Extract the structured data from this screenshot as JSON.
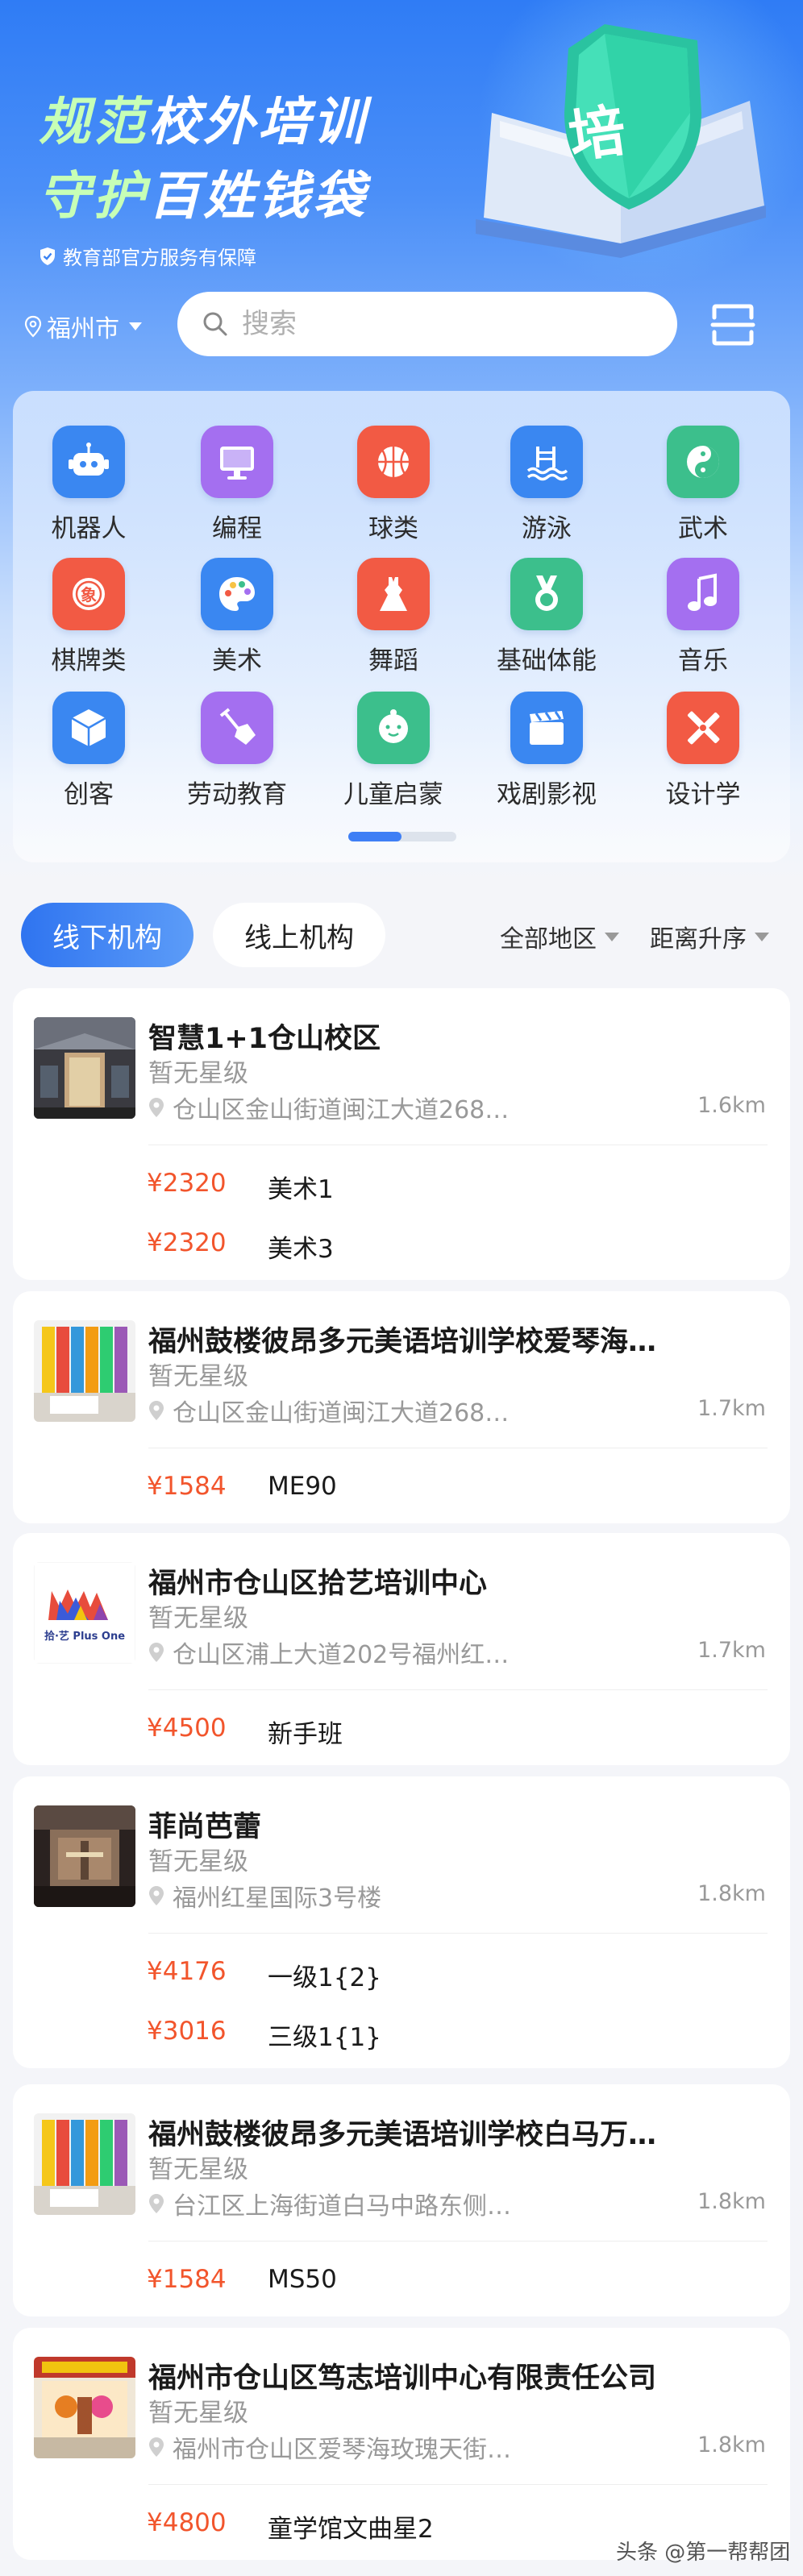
{
  "banner": {
    "line1_hl": "规范",
    "line1_rest": "校外培训",
    "line2_hl": "守护",
    "line2_rest": "百姓钱袋",
    "subtitle": "教育部官方服务有保障",
    "badge_char": "培"
  },
  "location": {
    "city": "福州市"
  },
  "search": {
    "placeholder": "搜索"
  },
  "categories": [
    {
      "label": "机器人",
      "icon": "robot-icon",
      "color": "#3a87f1"
    },
    {
      "label": "编程",
      "icon": "monitor-icon",
      "color": "#a46ff0"
    },
    {
      "label": "球类",
      "icon": "basketball-icon",
      "color": "#f25a44"
    },
    {
      "label": "游泳",
      "icon": "swimming-icon",
      "color": "#3a87f1"
    },
    {
      "label": "武术",
      "icon": "taiji-icon",
      "color": "#3cbf8c"
    },
    {
      "label": "棋牌类",
      "icon": "chess-icon",
      "color": "#f25a44"
    },
    {
      "label": "美术",
      "icon": "palette-icon",
      "color": "#3a87f1"
    },
    {
      "label": "舞蹈",
      "icon": "dress-icon",
      "color": "#f25a44"
    },
    {
      "label": "基础体能",
      "icon": "medal-icon",
      "color": "#3cbf8c"
    },
    {
      "label": "音乐",
      "icon": "music-note-icon",
      "color": "#a46ff0"
    },
    {
      "label": "创客",
      "icon": "cube-icon",
      "color": "#3a87f1"
    },
    {
      "label": "劳动教育",
      "icon": "shovel-icon",
      "color": "#a46ff0"
    },
    {
      "label": "儿童启蒙",
      "icon": "baby-icon",
      "color": "#3cbf8c"
    },
    {
      "label": "戏剧影视",
      "icon": "clapper-icon",
      "color": "#3a87f1"
    },
    {
      "label": "设计学",
      "icon": "design-tools-icon",
      "color": "#f25a44"
    }
  ],
  "tabs": {
    "offline": "线下机构",
    "online": "线上机构"
  },
  "filters": {
    "region": "全部地区",
    "sort": "距离升序"
  },
  "institutions": [
    {
      "name": "智慧1+1仓山校区",
      "rating": "暂无星级",
      "address": "仓山区金山街道闽江大道268…",
      "distance": "1.6km",
      "courses": [
        {
          "price": "¥2320",
          "name": "美术1"
        },
        {
          "price": "¥2320",
          "name": "美术3"
        }
      ]
    },
    {
      "name": "福州鼓楼彼昂多元美语培训学校爱琴海…",
      "rating": "暂无星级",
      "address": "仓山区金山街道闽江大道268…",
      "distance": "1.7km",
      "courses": [
        {
          "price": "¥1584",
          "name": "ME90"
        }
      ]
    },
    {
      "name": "福州市仓山区拾艺培训中心",
      "rating": "暂无星级",
      "address": "仓山区浦上大道202号福州红…",
      "distance": "1.7km",
      "logo_text": "拾·艺 Plus One",
      "courses": [
        {
          "price": "¥4500",
          "name": "新手班"
        }
      ]
    },
    {
      "name": "菲尚芭蕾",
      "rating": "暂无星级",
      "address": "福州红星国际3号楼",
      "distance": "1.8km",
      "courses": [
        {
          "price": "¥4176",
          "name": "一级1{2}"
        },
        {
          "price": "¥3016",
          "name": "三级1{1}"
        }
      ]
    },
    {
      "name": "福州鼓楼彼昂多元美语培训学校白马万…",
      "rating": "暂无星级",
      "address": "台江区上海街道白马中路东侧…",
      "distance": "1.8km",
      "courses": [
        {
          "price": "¥1584",
          "name": "MS50"
        }
      ]
    },
    {
      "name": "福州市仓山区笃志培训中心有限责任公司",
      "rating": "暂无星级",
      "address": "福州市仓山区爱琴海玫瑰天街…",
      "distance": "1.8km",
      "courses": [
        {
          "price": "¥4800",
          "name": "童学馆文曲星2"
        }
      ]
    }
  ],
  "watermark": "头条 @第一帮帮团"
}
